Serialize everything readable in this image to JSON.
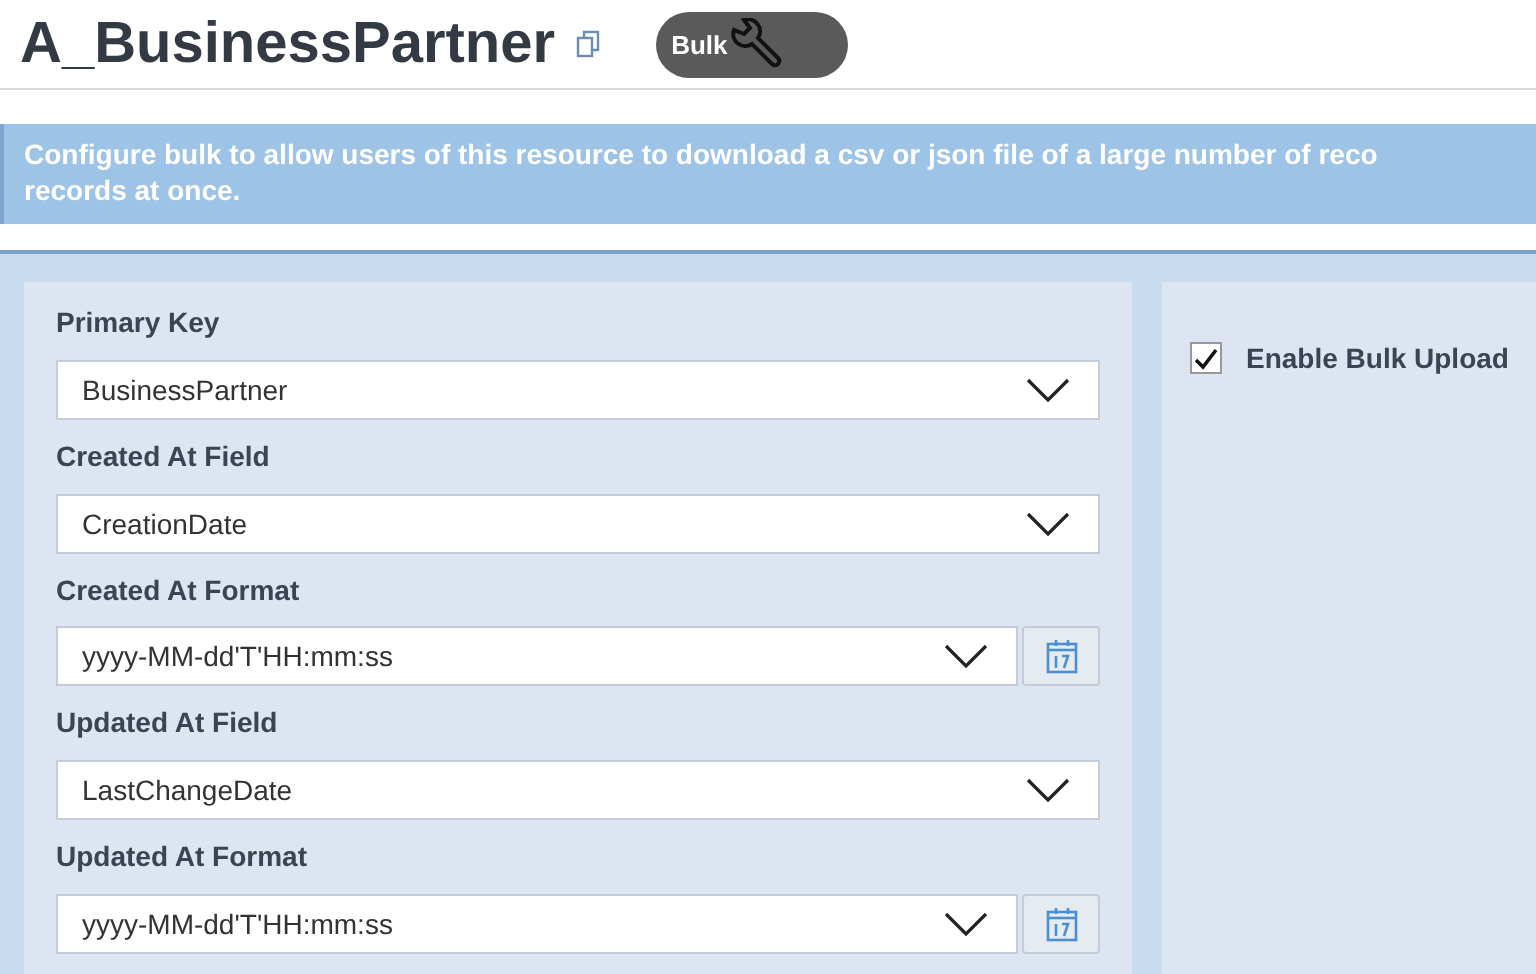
{
  "header": {
    "title": "A_BusinessPartner",
    "badge": "Bulk"
  },
  "banner": {
    "lines": [
      "Configure bulk to allow users of this resource to download a csv or json file of a large number of reco",
      "records at once."
    ]
  },
  "fields": [
    {
      "label": "Primary Key",
      "value": "BusinessPartner",
      "kind": "select"
    },
    {
      "label": "Created At Field",
      "value": "CreationDate",
      "kind": "select"
    },
    {
      "label": "Created At Format",
      "value": "yyyy-MM-dd'T'HH:mm:ss",
      "kind": "date_format"
    },
    {
      "label": "Updated At Field",
      "value": "LastChangeDate",
      "kind": "select"
    },
    {
      "label": "Updated At Format",
      "value": "yyyy-MM-dd'T'HH:mm:ss",
      "kind": "date_format"
    }
  ],
  "options": [
    {
      "label": "Enable Bulk Upload",
      "checked": true
    }
  ]
}
